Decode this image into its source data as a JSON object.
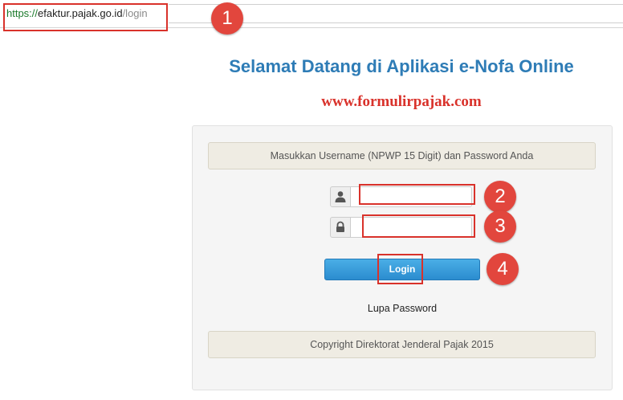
{
  "browser": {
    "url_scheme": "https://",
    "url_host": "efaktur.pajak.go.id",
    "url_path": "/login"
  },
  "annotations": {
    "badges": [
      "1",
      "2",
      "3",
      "4"
    ],
    "highlight_color": "#d9322b"
  },
  "page": {
    "title": "Selamat Datang di Aplikasi e-Nofa Online",
    "watermark": "www.formulirpajak.com",
    "title_color": "#2e7cb6"
  },
  "login_form": {
    "instruction": "Masukkan Username (NPWP 15 Digit) dan Password Anda",
    "username_icon": "user-icon",
    "username_value": "",
    "password_icon": "lock-icon",
    "password_value": "",
    "login_label": "Login",
    "login_color": "#2b8ccf",
    "forgot_password": "Lupa Password",
    "copyright": "Copyright Direktorat Jenderal Pajak 2015"
  }
}
